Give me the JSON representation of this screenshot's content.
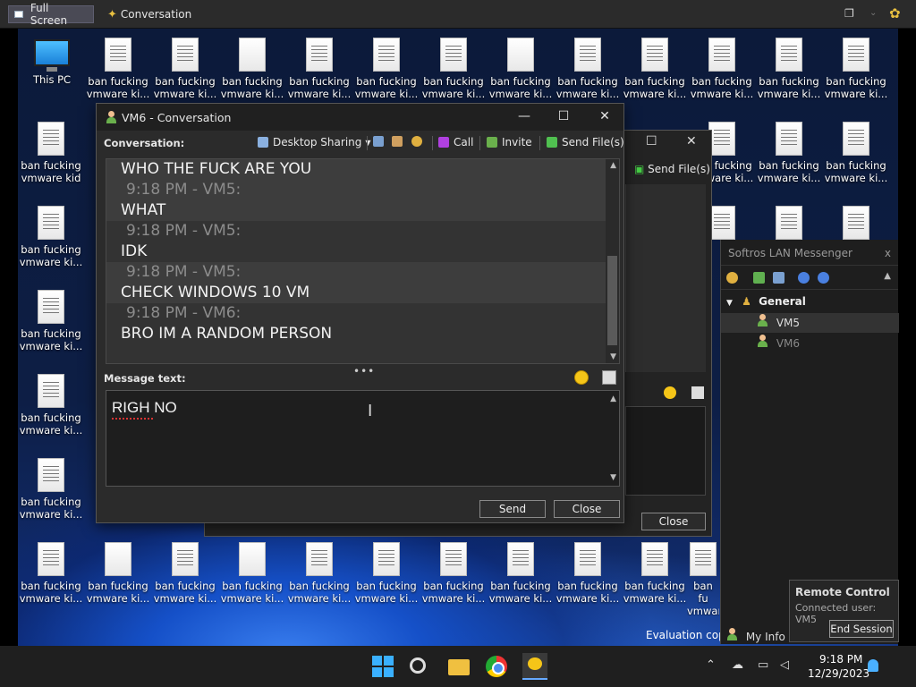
{
  "viewer": {
    "full_screen_label": "Full Screen",
    "conversation_tab": "Conversation"
  },
  "desktop": {
    "this_pc_label": "This PC",
    "file_label_1": "ban fucking",
    "file_label_2": "vmware ki...",
    "file_label_2_alt": "vmware kid",
    "file_label_2_short": "vmware ki",
    "file_label_partial": "b",
    "file_label_partial2": "v",
    "file_label_partial3": "ban fu",
    "evaluation": "Evaluation copy"
  },
  "back_window": {
    "send_files": "Send File(s)",
    "close": "Close"
  },
  "main_window": {
    "title": "VM6 - Conversation",
    "conversation_label": "Conversation:",
    "desktop_sharing": "Desktop Sharing",
    "call": "Call",
    "invite": "Invite",
    "send_files": "Send File(s)",
    "messages": [
      {
        "kind": "text",
        "text": "WHO THE FUCK ARE YOU",
        "hi": true
      },
      {
        "kind": "time",
        "text": "9:18 PM - VM5:",
        "hi": true
      },
      {
        "kind": "text",
        "text": "WHAT",
        "hi": true
      },
      {
        "kind": "time",
        "text": "9:18 PM - VM5:",
        "hi": false
      },
      {
        "kind": "text",
        "text": "IDK",
        "hi": false
      },
      {
        "kind": "time",
        "text": "9:18 PM - VM5:",
        "hi": true
      },
      {
        "kind": "text",
        "text": "CHECK WINDOWS 10 VM",
        "hi": true
      },
      {
        "kind": "time",
        "text": "9:18 PM - VM6:",
        "hi": false
      },
      {
        "kind": "text",
        "text": "BRO IM A RANDOM PERSON",
        "hi": false
      }
    ],
    "message_text_label": "Message text:",
    "input_value": "RIGH NO",
    "send": "Send",
    "close": "Close"
  },
  "messenger": {
    "title": "Softros LAN Messenger",
    "close_x": "x",
    "group": "General",
    "users": [
      "VM5",
      "VM6"
    ],
    "remote_control": "Remote Control",
    "connected_user": "Connected user: VM5",
    "end_session": "End Session",
    "my_info": "My Info"
  },
  "taskbar": {
    "time": "9:18 PM",
    "date": "12/29/2023"
  }
}
